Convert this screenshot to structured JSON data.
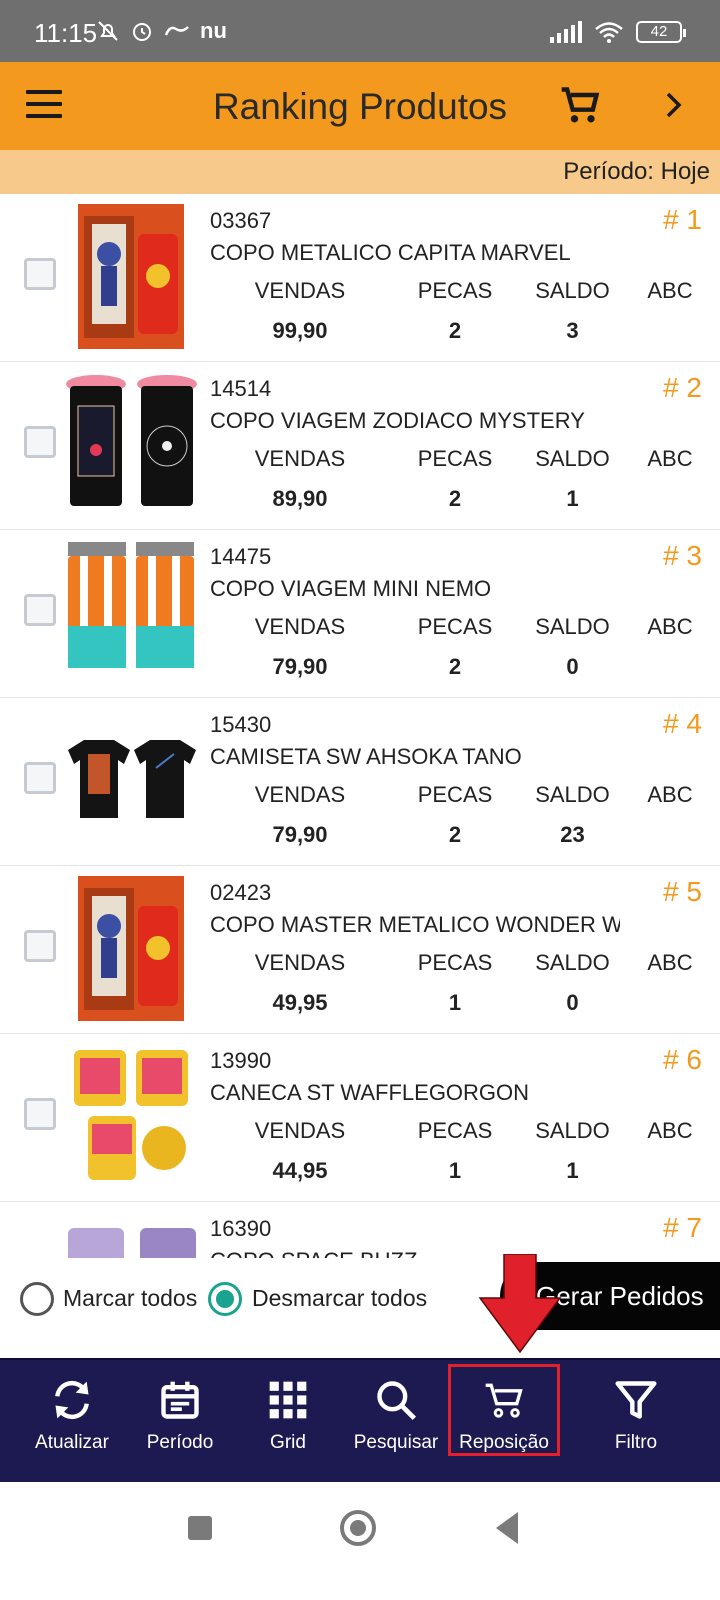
{
  "status_bar": {
    "time": "11:15",
    "left_icons": [
      "muted-bell-icon",
      "alarm-icon",
      "ifood-icon",
      "nu-icon"
    ],
    "nu_text": "nu",
    "battery": "42"
  },
  "header": {
    "title": "Ranking Produtos",
    "period": "Período: Hoje"
  },
  "column_labels": {
    "vendas": "VENDAS",
    "pecas": "PECAS",
    "saldo": "SALDO",
    "abc": "ABC"
  },
  "products": [
    {
      "code": "03367",
      "name": "COPO METALICO CAPITA MARVEL",
      "rank": "# 1",
      "vendas": "99,90",
      "pecas": "2",
      "saldo": "3",
      "thumb": "red-tumbler-box"
    },
    {
      "code": "14514",
      "name": "COPO VIAGEM ZODIACO MYSTERY",
      "rank": "# 2",
      "vendas": "89,90",
      "pecas": "2",
      "saldo": "1",
      "thumb": "black-pink-travel-cups"
    },
    {
      "code": "14475",
      "name": "COPO VIAGEM MINI NEMO",
      "rank": "# 3",
      "vendas": "79,90",
      "pecas": "2",
      "saldo": "0",
      "thumb": "orange-striped-travel-cups"
    },
    {
      "code": "15430",
      "name": "CAMISETA SW AHSOKA TANO",
      "rank": "# 4",
      "vendas": "79,90",
      "pecas": "2",
      "saldo": "23",
      "thumb": "black-tshirts"
    },
    {
      "code": "02423",
      "name": "COPO MASTER METALICO WONDER W",
      "rank": "# 5",
      "vendas": "49,95",
      "pecas": "1",
      "saldo": "0",
      "thumb": "red-tumbler-box"
    },
    {
      "code": "13990",
      "name": "CANECA ST WAFFLEGORGON",
      "rank": "# 6",
      "vendas": "44,95",
      "pecas": "1",
      "saldo": "1",
      "thumb": "yellow-mugs"
    },
    {
      "code": "16390",
      "name": "COPO SPACE BUZZ",
      "rank": "# 7",
      "vendas": "",
      "pecas": "",
      "saldo": "",
      "thumb": "purple-cups"
    }
  ],
  "selection": {
    "mark_all": "Marcar todos",
    "unmark_all": "Desmarcar todos",
    "selected": "unmark_all"
  },
  "gerar_button": "Gerar Pedidos",
  "bottom_nav": [
    {
      "label": "Atualizar",
      "icon": "refresh-icon"
    },
    {
      "label": "Período",
      "icon": "calendar-icon"
    },
    {
      "label": "Grid",
      "icon": "grid-icon"
    },
    {
      "label": "Pesquisar",
      "icon": "search-icon"
    },
    {
      "label": "Reposição",
      "icon": "cart-icon"
    },
    {
      "label": "Filtro",
      "icon": "filter-icon"
    }
  ],
  "colors": {
    "header": "#f39a1e",
    "period_bar": "#f7c98a",
    "rank": "#f39a1e",
    "bottom_nav": "#1d1a52",
    "radio_selected": "#1aa38e",
    "annotation": "#e0202a"
  }
}
